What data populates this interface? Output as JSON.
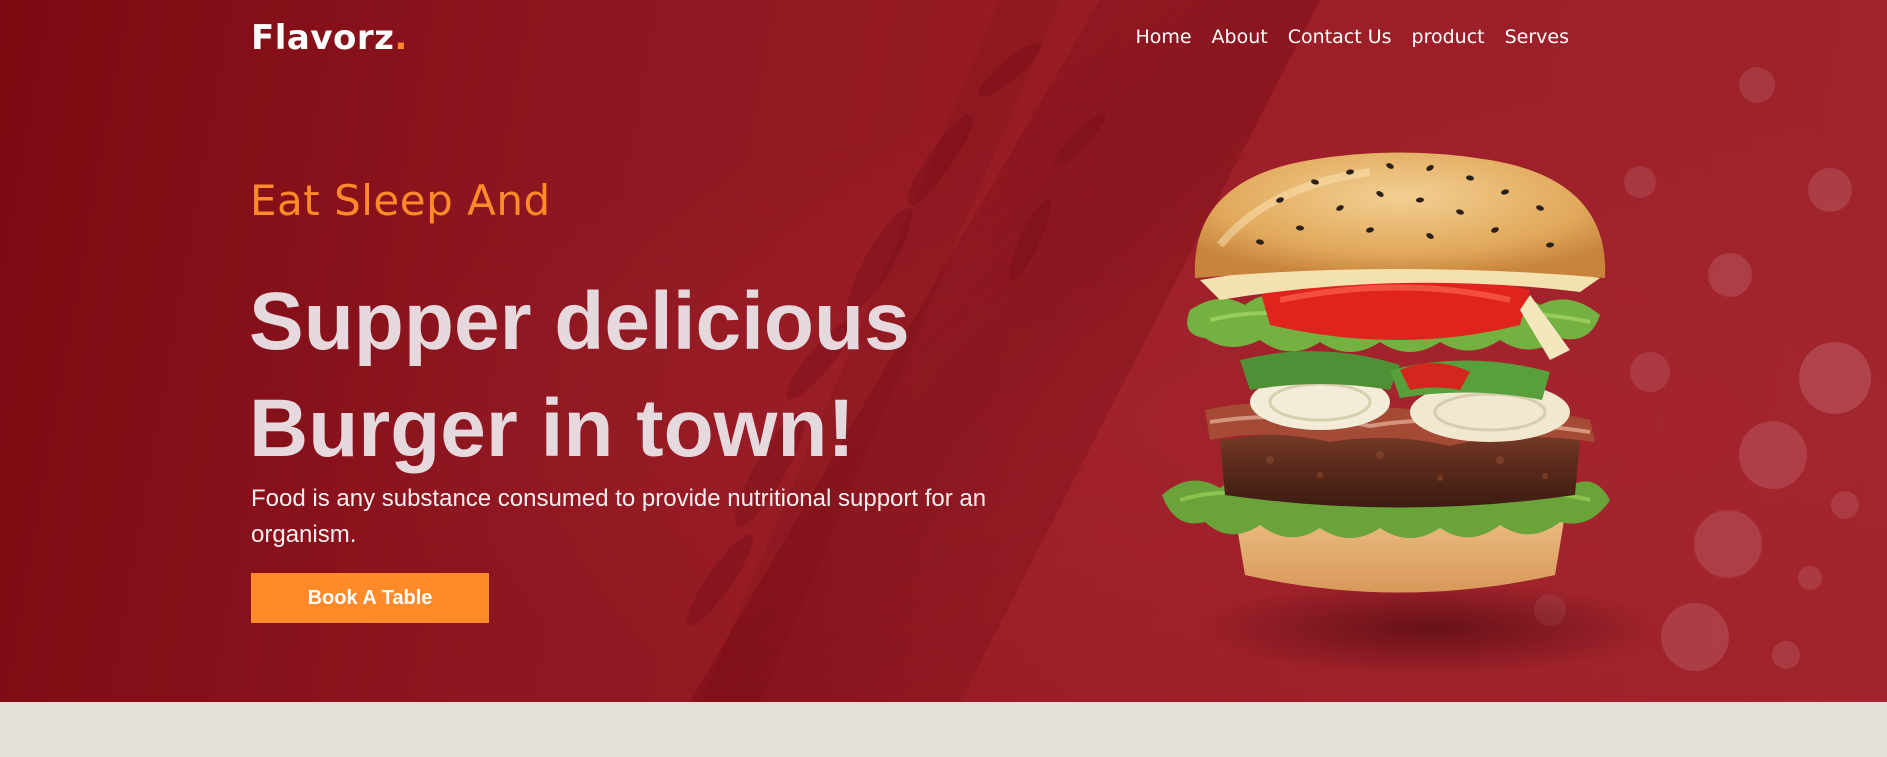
{
  "brand": {
    "name": "Flavorz",
    "dot": ".",
    "accent_color": "#ff8a2a"
  },
  "nav": {
    "items": [
      {
        "label": "Home"
      },
      {
        "label": "About"
      },
      {
        "label": "Contact Us"
      },
      {
        "label": "product"
      },
      {
        "label": "Serves"
      }
    ]
  },
  "hero": {
    "tagline": "Eat Sleep And",
    "headline_line1": "Supper delicious",
    "headline_line2": "Burger in town!",
    "description": "Food is any substance consumed to provide nutritional support for an organism.",
    "cta_label": "Book A Table",
    "background_color": "#9a1d27",
    "image_icon": "burger-image"
  }
}
